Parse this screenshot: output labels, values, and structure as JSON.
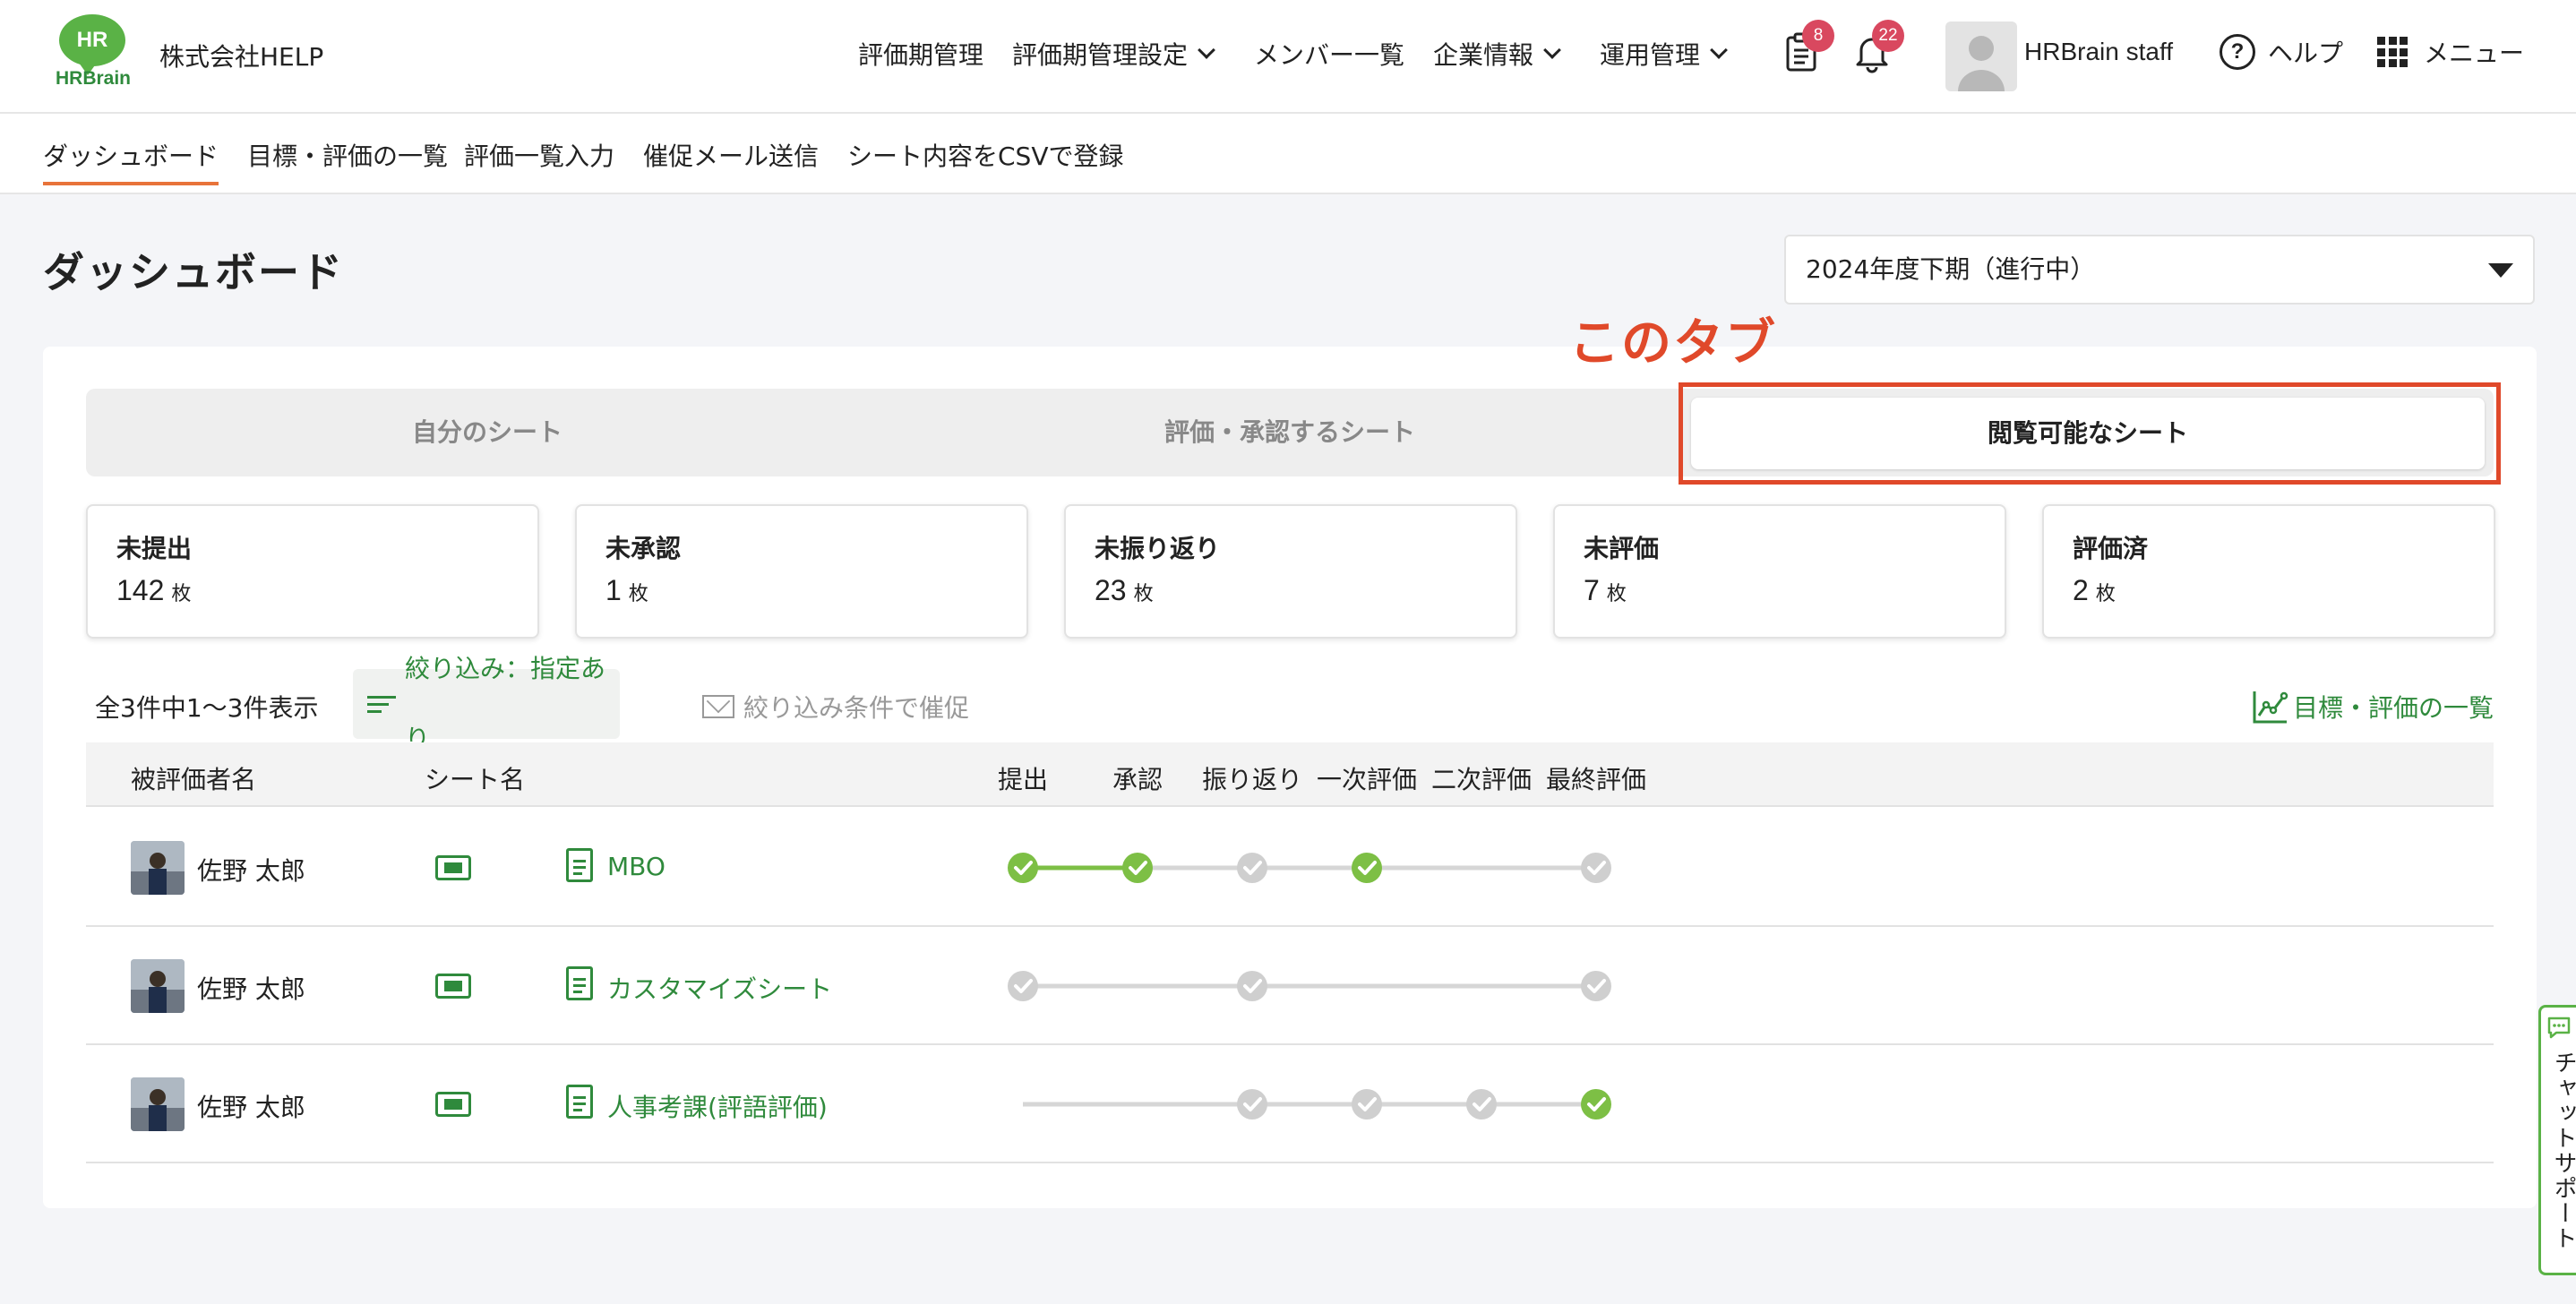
{
  "header": {
    "logo_text": "HR",
    "logo_word": "HRBrain",
    "company": "株式会社HELP",
    "nav": [
      {
        "label": "評価期管理",
        "dropdown": false
      },
      {
        "label": "評価期管理設定",
        "dropdown": true
      },
      {
        "label": "メンバー一覧",
        "dropdown": false
      },
      {
        "label": "企業情報",
        "dropdown": true
      },
      {
        "label": "運用管理",
        "dropdown": true
      }
    ],
    "tasks_badge": "8",
    "notifications_badge": "22",
    "user_name": "HRBrain staff",
    "help_label": "ヘルプ",
    "menu_label": "メニュー"
  },
  "subnav": {
    "items": [
      {
        "label": "ダッシュボード",
        "active": true
      },
      {
        "label": "目標・評価の一覧",
        "active": false
      },
      {
        "label": "評価一覧入力",
        "active": false
      },
      {
        "label": "催促メール送信",
        "active": false
      },
      {
        "label": "シート内容をCSVで登録",
        "active": false
      }
    ]
  },
  "page": {
    "title": "ダッシュボード",
    "period_selected": "2024年度下期（進行中）",
    "annotation": "このタブ"
  },
  "tabs": [
    {
      "label": "自分のシート",
      "active": false
    },
    {
      "label": "評価・承認するシート",
      "active": false
    },
    {
      "label": "閲覧可能なシート",
      "active": true
    }
  ],
  "stats": [
    {
      "label": "未提出",
      "value": "142",
      "unit": "枚"
    },
    {
      "label": "未承認",
      "value": "1",
      "unit": "枚"
    },
    {
      "label": "未振り返り",
      "value": "23",
      "unit": "枚"
    },
    {
      "label": "未評価",
      "value": "7",
      "unit": "枚"
    },
    {
      "label": "評価済",
      "value": "2",
      "unit": "枚"
    }
  ],
  "toolbar": {
    "count_text": "全3件中1〜3件表示",
    "filter_label": "絞り込み：指定あり",
    "remind_label": "絞り込み条件で催促",
    "list_link": "目標・評価の一覧"
  },
  "table": {
    "columns": {
      "evaluatee": "被評価者名",
      "sheet": "シート名",
      "steps": [
        "提出",
        "承認",
        "振り返り",
        "一次評価",
        "二次評価",
        "最終評価"
      ]
    },
    "rows": [
      {
        "name": "佐野 太郎",
        "sheet": "MBO",
        "steps": [
          "done",
          "done",
          "pending",
          "done",
          "none",
          "pending"
        ]
      },
      {
        "name": "佐野 太郎",
        "sheet": "カスタマイズシート",
        "steps": [
          "pending",
          "none",
          "pending",
          "none",
          "none",
          "pending"
        ]
      },
      {
        "name": "佐野 太郎",
        "sheet": "人事考課(評語評価)",
        "steps": [
          "none",
          "none",
          "pending",
          "pending",
          "pending",
          "done"
        ]
      }
    ]
  },
  "side_tab": {
    "label": "チャットサポート"
  },
  "colors": {
    "brand_green": "#5ab246",
    "link_green": "#2f8a3c",
    "step_done": "#7dbf45",
    "step_pending": "#cfcfcf",
    "annotation_red": "#e0492a",
    "badge_red": "#d9485f",
    "subnav_active": "#e8733a"
  }
}
